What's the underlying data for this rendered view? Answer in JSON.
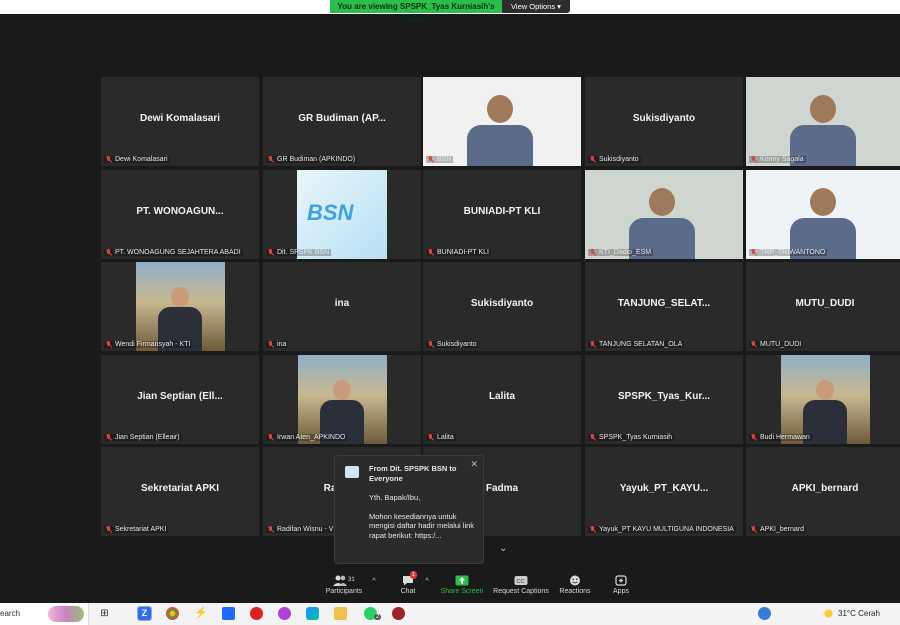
{
  "banner": {
    "viewing": "You are viewing SPSPK_Tyas Kurniasih's screen",
    "view_options": "View Options"
  },
  "tiles": [
    {
      "name": "Dewi Komalasari",
      "label": "Dewi Komalasari",
      "type": "name"
    },
    {
      "name": "GR Budiman (AP...",
      "label": "GR Budiman (APKINDO)",
      "type": "name"
    },
    {
      "name": "",
      "label": "BSN",
      "type": "video"
    },
    {
      "name": "Sukisdiyanto",
      "label": "Sukisdiyanto",
      "type": "name"
    },
    {
      "name": "",
      "label": "Konny Sagala",
      "type": "video"
    },
    {
      "name": "PT. WONOAGUN...",
      "label": "PT. WONOAGUNG SEJAHTERA ABADI",
      "type": "name"
    },
    {
      "name": "",
      "label": "Dit. SPSPK BSN",
      "type": "logo"
    },
    {
      "name": "BUNIADI-PT KLI",
      "label": "BUNIADI-PT KLI",
      "type": "name"
    },
    {
      "name": "",
      "label": "KTI_Dadio_ESM",
      "type": "video"
    },
    {
      "name": "",
      "label": "TRP_TRIWANTONO",
      "type": "video"
    },
    {
      "name": "",
      "label": "Wendi Firmansyah - KTI",
      "type": "photo"
    },
    {
      "name": "ina",
      "label": "ina",
      "type": "name"
    },
    {
      "name": "Sukisdiyanto",
      "label": "Sukisdiyanto",
      "type": "name"
    },
    {
      "name": "TANJUNG_SELAT...",
      "label": "TANJUNG SELATAN_OLA",
      "type": "name"
    },
    {
      "name": "MUTU_DUDI",
      "label": "MUTU_DUDI",
      "type": "name"
    },
    {
      "name": "Jian Septian (Ell...",
      "label": "Jian Septian (Elleair)",
      "type": "name"
    },
    {
      "name": "",
      "label": "Irwan Aten_APKINDO",
      "type": "photo"
    },
    {
      "name": "Lalita",
      "label": "Lalita",
      "type": "name"
    },
    {
      "name": "SPSPK_Tyas_Kur...",
      "label": "SPSPK_Tyas Kurniasih",
      "type": "name"
    },
    {
      "name": "",
      "label": "Budi Hermawan",
      "type": "photo"
    },
    {
      "name": "Sekretariat APKI",
      "label": "Sekretariat APKI",
      "type": "name"
    },
    {
      "name": "Radifan",
      "label": "Radifan Wisnu - V",
      "type": "name"
    },
    {
      "name": "Fadma",
      "label": "",
      "type": "name"
    },
    {
      "name": "Yayuk_PT_KAYU...",
      "label": "Yayuk_PT KAYU MULTIGUNA INDONESIA",
      "type": "name"
    },
    {
      "name": "APKI_bernard",
      "label": "APKI_bernard",
      "type": "name"
    }
  ],
  "chat_popup": {
    "from": "From Dit. SPSPK BSN to Everyone",
    "greeting": "Yth. Bapak/Ibu,",
    "message": "Mohon kesediannya untuk mengisi daftar hadir melalui link rapat berikut: https:/..."
  },
  "toolbar": {
    "participants_count": "31",
    "participants": "Participants",
    "chat_badge": "1",
    "chat": "Chat",
    "share_screen": "Share Screen",
    "request_captions": "Request Captions",
    "reactions": "Reactions",
    "apps": "Apps"
  },
  "taskbar": {
    "search": "earch",
    "weather": "31°C  Cerah",
    "whatsapp_badge": "2",
    "chrome_badge": "6"
  },
  "colors": {
    "share_green": "#2bbf4a",
    "active_border": "#c6e35d",
    "mic_muted": "#e04040"
  }
}
